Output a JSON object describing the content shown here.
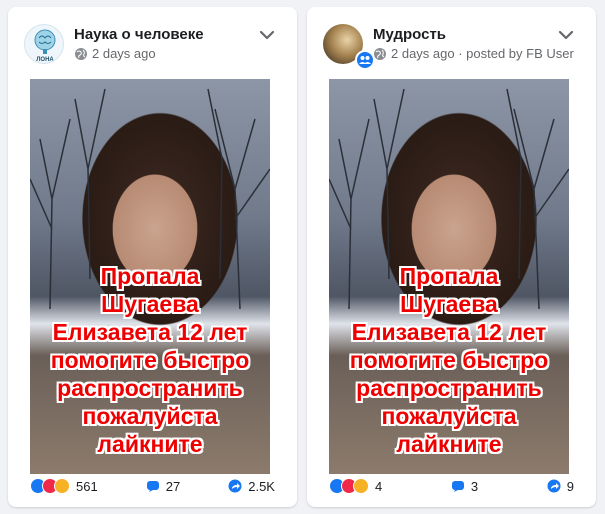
{
  "posts": [
    {
      "page_name": "Наука о человеке",
      "meta": "2 days ago",
      "avatar_text": "ЛОНА",
      "overlay_lines": [
        "Пропала",
        "Шугаева",
        "Елизавета 12 лет",
        "помогите быстро",
        "распространить",
        "пожалуйста",
        "лайкните"
      ],
      "reactions": "561",
      "comments": "27",
      "shares": "2.5K"
    },
    {
      "page_name": "Мудрость",
      "meta": "2 days ago · posted by FB User",
      "overlay_lines": [
        "Пропала",
        "Шугаева",
        "Елизавета 12 лет",
        "помогите быстро",
        "распространить",
        "пожалуйста",
        "лайкните"
      ],
      "reactions": "4",
      "comments": "3",
      "shares": "9"
    }
  ],
  "colors": {
    "background": "#f0f2f5",
    "overlay_text": "#ee0000",
    "accent": "#1877f2",
    "meta_text": "#65676b"
  },
  "icons": [
    "globe-icon",
    "chevron-down-icon",
    "comment-icon",
    "share-icon",
    "like-reaction-icon",
    "love-reaction-icon",
    "haha-reaction-icon"
  ]
}
